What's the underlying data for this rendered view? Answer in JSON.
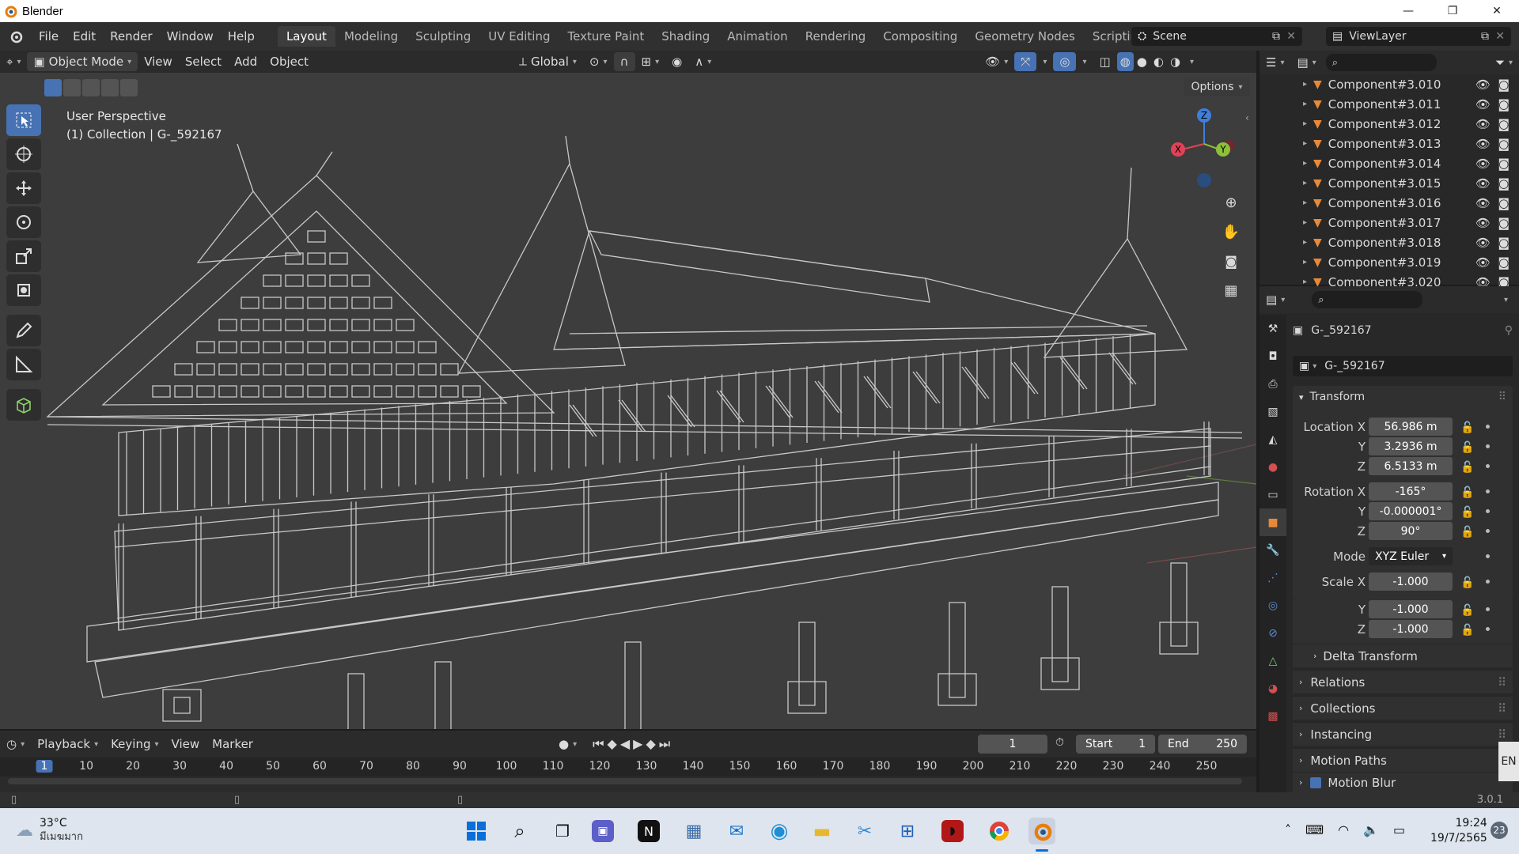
{
  "app": {
    "title": "Blender",
    "version": "3.0.1"
  },
  "menu": [
    "File",
    "Edit",
    "Render",
    "Window",
    "Help"
  ],
  "workspaces": [
    "Layout",
    "Modeling",
    "Sculpting",
    "UV Editing",
    "Texture Paint",
    "Shading",
    "Animation",
    "Rendering",
    "Compositing",
    "Geometry Nodes",
    "Scripting"
  ],
  "active_workspace": "Layout",
  "scene": {
    "name": "Scene",
    "view_layer": "ViewLayer"
  },
  "viewport_header": {
    "mode": "Object Mode",
    "menus": [
      "View",
      "Select",
      "Add",
      "Object"
    ],
    "orientation": "Global",
    "options": "Options"
  },
  "viewport": {
    "perspective": "User Perspective",
    "collection_line": "(1) Collection | G-_592167"
  },
  "gizmo": {
    "x": "X",
    "y": "Y",
    "z": "Z"
  },
  "outliner": {
    "items": [
      "Component#3.010",
      "Component#3.011",
      "Component#3.012",
      "Component#3.013",
      "Component#3.014",
      "Component#3.015",
      "Component#3.016",
      "Component#3.017",
      "Component#3.018",
      "Component#3.019",
      "Component#3.020"
    ]
  },
  "properties": {
    "object_name": "G-_592167",
    "data_name": "G-_592167",
    "transform_title": "Transform",
    "location": {
      "label": "Location X",
      "x": "56.986 m",
      "y": "3.2936 m",
      "z": "6.5133 m"
    },
    "rotation": {
      "label": "Rotation X",
      "x": "-165°",
      "y": "-0.000001°",
      "z": "90°"
    },
    "mode": {
      "label": "Mode",
      "value": "XYZ Euler"
    },
    "scale": {
      "label": "Scale X",
      "x": "-1.000",
      "y": "-1.000",
      "z": "-1.000"
    },
    "axis_y": "Y",
    "axis_z": "Z",
    "sections": [
      "Delta Transform",
      "Relations",
      "Collections",
      "Instancing",
      "Motion Paths",
      "Motion Blur"
    ]
  },
  "timeline": {
    "menus": [
      "Playback",
      "Keying",
      "View",
      "Marker"
    ],
    "current_frame": "1",
    "start_label": "Start",
    "start": "1",
    "end_label": "End",
    "end": "250",
    "ruler": [
      "1",
      "10",
      "20",
      "30",
      "40",
      "50",
      "60",
      "70",
      "80",
      "90",
      "100",
      "110",
      "120",
      "130",
      "140",
      "150",
      "160",
      "170",
      "180",
      "190",
      "200",
      "210",
      "220",
      "230",
      "240",
      "250"
    ]
  },
  "taskbar": {
    "weather_temp": "33°C",
    "weather_desc": "มีเมฆมาก",
    "time": "19:24",
    "date": "19/7/2565",
    "notifications": "23",
    "lang": "EN"
  },
  "colors": {
    "accent": "#4772b3",
    "axis_x": "#e34256",
    "axis_y": "#8cc03a",
    "axis_z": "#3f7fdb",
    "object_orange": "#e8893a"
  }
}
